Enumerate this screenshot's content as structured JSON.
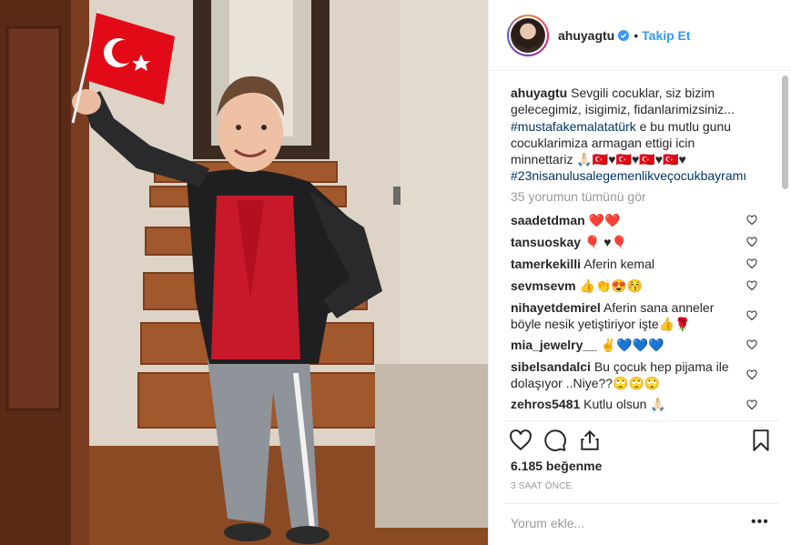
{
  "post": {
    "username": "ahuyagtu",
    "follow_label": "Takip Et",
    "separator": "•",
    "caption": {
      "username": "ahuyagtu",
      "text1": "Sevgili cocuklar, siz bizim gelecegimiz, isigimiz, fidanlarimizsiniz...",
      "hashtag1": "#mustafakemalatatürk",
      "text2": "e bu mutlu gunu cocuklarimiza armagan ettigi icin minnettariz 🙏🏻🇹🇷♥🇹🇷♥🇹🇷♥🇹🇷♥",
      "hashtag2": "#23nisanulusalegemenlikveçocukbayramı"
    },
    "view_all_comments": "35 yorumun tümünü gör",
    "comments": [
      {
        "username": "saadetdman",
        "text": "❤️❤️"
      },
      {
        "username": "tansuoskay",
        "text": "🎈 ♥🎈"
      },
      {
        "username": "tamerkekilli",
        "text": "Aferin kemal"
      },
      {
        "username": "sevmsevm",
        "text": "👍👏😍😚"
      },
      {
        "username": "nihayetdemirel",
        "text": "Aferin sana anneler böyle nesik yetiştiriyor işte👍🌹"
      },
      {
        "username": "mia_jewelry__",
        "text": "✌️💙💙💙"
      },
      {
        "username": "sibelsandalci",
        "text": "Bu çocuk hep pijama ile dolaşıyor ..Niye??🙄🙄🙄"
      },
      {
        "username": "zehros5481",
        "text": "Kutlu olsun 🙏🏻"
      }
    ],
    "likes": "6.185 beğenme",
    "time": "3 SAAT ÖNCE",
    "comment_placeholder": "Yorum ekle...",
    "more_label": "•••"
  },
  "icons": [
    "verified-badge-icon",
    "heart-icon",
    "comment-icon",
    "share-icon",
    "bookmark-icon",
    "more-options-icon"
  ],
  "colors": {
    "link": "#3897f0",
    "hashtag": "#003569",
    "muted": "#999999",
    "flag_red": "#e30a17"
  }
}
